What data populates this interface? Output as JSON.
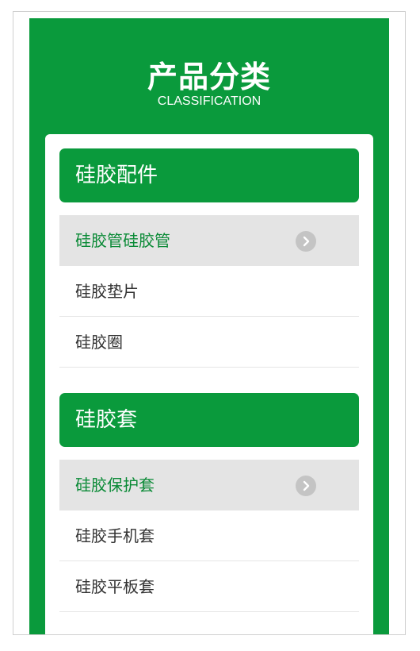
{
  "header": {
    "title": "产品分类",
    "subtitle": "CLASSIFICATION"
  },
  "groups": [
    {
      "title": "硅胶配件",
      "items": [
        {
          "label": "硅胶管硅胶管",
          "active": true
        },
        {
          "label": "硅胶垫片",
          "active": false
        },
        {
          "label": "硅胶圈",
          "active": false
        }
      ]
    },
    {
      "title": "硅胶套",
      "items": [
        {
          "label": "硅胶保护套",
          "active": true
        },
        {
          "label": "硅胶手机套",
          "active": false
        },
        {
          "label": "硅胶平板套",
          "active": false
        }
      ]
    }
  ],
  "colors": {
    "brand_green": "#0a9a3c",
    "active_text": "#0a8a36",
    "active_bg": "#e4e4e4",
    "arrow_bg": "#c4c4c4"
  },
  "icons": {
    "active_item_icon": "chevron-right-circle-icon"
  }
}
